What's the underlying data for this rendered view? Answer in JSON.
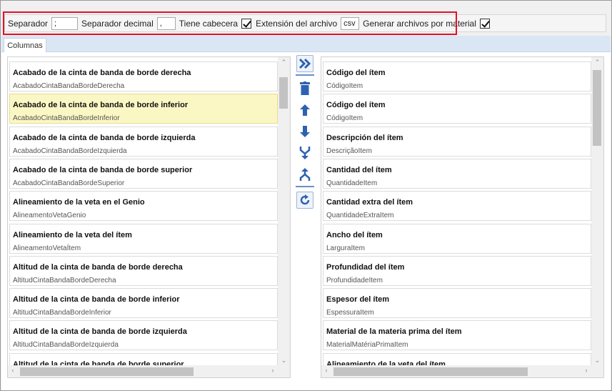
{
  "options": {
    "separator_label": "Separador",
    "separator_value": ";",
    "decimal_label": "Separador decimal",
    "decimal_value": ",",
    "header_label": "Tiene cabecera",
    "header_checked": true,
    "extension_label": "Extensión del archivo",
    "extension_value": "csv",
    "per_material_label": "Generar archivos por material",
    "per_material_checked": true
  },
  "tabs": [
    {
      "label": "Columnas",
      "active": true
    }
  ],
  "available_columns": [
    {
      "title": "Acabado de la cinta de banda de borde derecha",
      "field": "AcabadoCintaBandaBordeDerecha"
    },
    {
      "title": "Acabado de la cinta de banda de borde inferior",
      "field": "AcabadoCintaBandaBordeInferior"
    },
    {
      "title": "Acabado de la cinta de banda de borde izquierda",
      "field": "AcabadoCintaBandaBordeIzquierda"
    },
    {
      "title": "Acabado de la cinta de banda de borde superior",
      "field": "AcabadoCintaBandaBordeSuperior"
    },
    {
      "title": "Alineamiento de la veta en el Genio",
      "field": "AlineamentoVetaGenio"
    },
    {
      "title": "Alineamiento de la veta del ítem",
      "field": "AlineamentoVetaÍtem"
    },
    {
      "title": "Altitud de la cinta de banda de borde derecha",
      "field": "AltitudCintaBandaBordeDerecha"
    },
    {
      "title": "Altitud de la cinta de banda de borde inferior",
      "field": "AltitudCintaBandaBordeInferior"
    },
    {
      "title": "Altitud de la cinta de banda de borde izquierda",
      "field": "AltitudCintaBandaBordeIzquierda"
    },
    {
      "title": "Altitud de la cinta de banda de borde superior",
      "field": ""
    }
  ],
  "available_selected_index": 1,
  "selected_columns": [
    {
      "title": "Código del ítem",
      "field": "CódigoItem"
    },
    {
      "title": "Código del ítem",
      "field": "CódigoItem"
    },
    {
      "title": "Descripción del ítem",
      "field": "DescriçãoItem"
    },
    {
      "title": "Cantidad del ítem",
      "field": "QuantidadeItem"
    },
    {
      "title": "Cantidad extra del ítem",
      "field": "QuantidadeExtraItem"
    },
    {
      "title": "Ancho del ítem",
      "field": "LarguraItem"
    },
    {
      "title": "Profundidad del ítem",
      "field": "ProfundidadeItem"
    },
    {
      "title": "Espesor del ítem",
      "field": "EspessuraItem"
    },
    {
      "title": "Material de la materia prima del ítem",
      "field": "MaterialMatériaPrimaItem"
    },
    {
      "title": "Alineamiento de la veta del ítem",
      "field": ""
    }
  ],
  "toolbar_icons": [
    "add-columns-icon",
    "delete-icon",
    "move-up-icon",
    "move-down-icon",
    "merge-icon",
    "split-icon",
    "refresh-icon"
  ],
  "colors": {
    "accent": "#3a6ab3",
    "highlight": "#fbf7c4",
    "outline": "#e0112b"
  }
}
